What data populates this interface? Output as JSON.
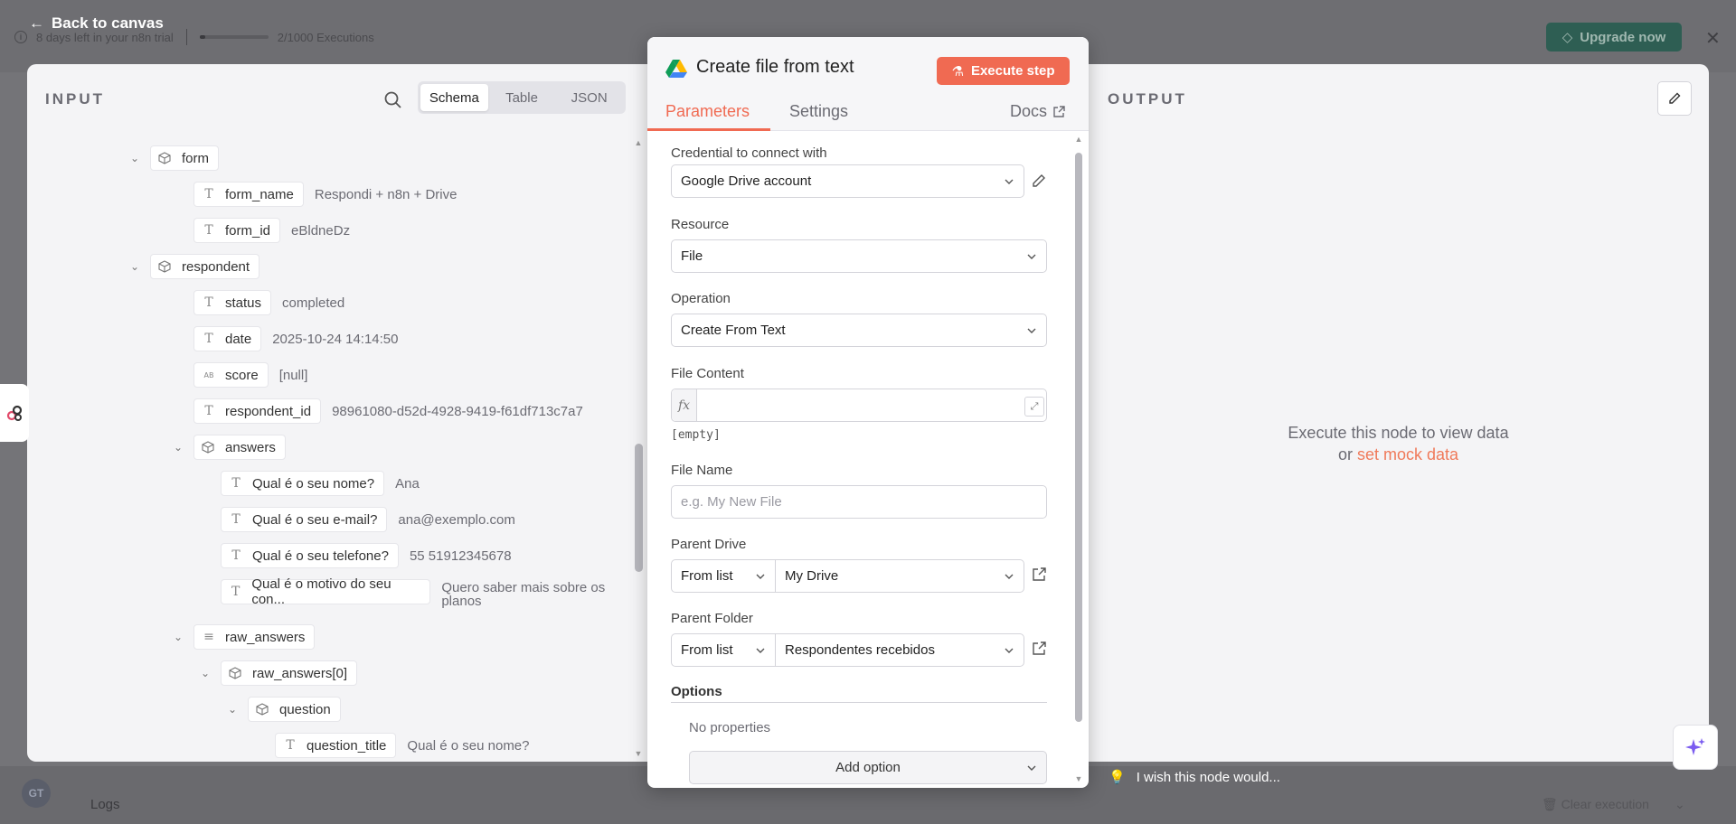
{
  "trial": {
    "text": "8 days left in your n8n trial",
    "executions": "2/1000 Executions",
    "usage_fraction": 0.002,
    "upgrade_label": "Upgrade now"
  },
  "nav": {
    "back_label": "Back to canvas"
  },
  "bottom": {
    "avatar_initials": "GT",
    "logs_label": "Logs",
    "clear_label": "Clear execution"
  },
  "input": {
    "title": "INPUT",
    "view_tabs": [
      "Schema",
      "Table",
      "JSON"
    ],
    "active_tab": "Schema",
    "rows": [
      {
        "depth": 0,
        "kind": "object",
        "key": "form",
        "value": ""
      },
      {
        "depth": 1,
        "kind": "text",
        "key": "form_name",
        "value": "Respondi + n8n + Drive"
      },
      {
        "depth": 1,
        "kind": "text",
        "key": "form_id",
        "value": "eBldneDz"
      },
      {
        "depth": 0,
        "kind": "object",
        "key": "respondent",
        "value": ""
      },
      {
        "depth": 1,
        "kind": "text",
        "key": "status",
        "value": "completed"
      },
      {
        "depth": 1,
        "kind": "text",
        "key": "date",
        "value": "2025-10-24 14:14:50"
      },
      {
        "depth": 1,
        "kind": "null",
        "key": "score",
        "value": "[null]"
      },
      {
        "depth": 1,
        "kind": "text",
        "key": "respondent_id",
        "value": "98961080-d52d-4928-9419-f61df713c7a7"
      },
      {
        "depth": 1,
        "kind": "object",
        "key": "answers",
        "value": ""
      },
      {
        "depth": 2,
        "kind": "text",
        "key": "Qual é o seu nome?",
        "value": "Ana"
      },
      {
        "depth": 2,
        "kind": "text",
        "key": "Qual é o seu e-mail?",
        "value": "ana@exemplo.com"
      },
      {
        "depth": 2,
        "kind": "text",
        "key": "Qual é o seu telefone?",
        "value": "55 51912345678"
      },
      {
        "depth": 2,
        "kind": "text",
        "key": "Qual é o motivo do seu con...",
        "value": "Quero saber mais sobre os planos"
      },
      {
        "depth": 1,
        "kind": "array",
        "key": "raw_answers",
        "value": ""
      },
      {
        "depth": 2,
        "kind": "object",
        "key": "raw_answers[0]",
        "value": ""
      },
      {
        "depth": 3,
        "kind": "object",
        "key": "question",
        "value": ""
      },
      {
        "depth": 4,
        "kind": "text",
        "key": "question_title",
        "value": "Qual é o seu nome?"
      }
    ]
  },
  "node": {
    "title": "Create file from text",
    "execute_label": "Execute step",
    "tabs": [
      "Parameters",
      "Settings"
    ],
    "docs_label": "Docs",
    "credential": {
      "label": "Credential to connect with",
      "value": "Google Drive account"
    },
    "resource": {
      "label": "Resource",
      "value": "File"
    },
    "operation": {
      "label": "Operation",
      "value": "Create From Text"
    },
    "file_content": {
      "label": "File Content",
      "fx": "fx",
      "empty_tag": "[empty]"
    },
    "file_name": {
      "label": "File Name",
      "placeholder": "e.g. My New File"
    },
    "parent_drive": {
      "label": "Parent Drive",
      "mode": "From list",
      "value": "My Drive"
    },
    "parent_folder": {
      "label": "Parent Folder",
      "mode": "From list",
      "value": "Respondentes recebidos"
    },
    "options": {
      "label": "Options",
      "empty": "No properties",
      "add_label": "Add option"
    }
  },
  "output": {
    "title": "OUTPUT",
    "message": "Execute this node to view data",
    "or": "or",
    "mock_link": "set mock data",
    "wish": "I wish this node would..."
  },
  "colors": {
    "accent": "#f06a52",
    "upgrade": "#2e5e53"
  }
}
